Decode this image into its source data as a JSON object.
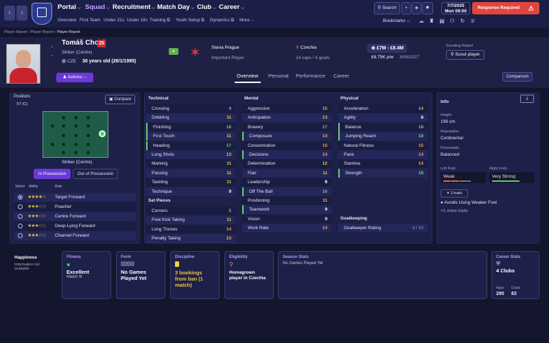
{
  "nav": {
    "main": [
      {
        "label": "Portal"
      },
      {
        "label": "Squad"
      },
      {
        "label": "Recruitment"
      },
      {
        "label": "Match Day"
      },
      {
        "label": "Club"
      },
      {
        "label": "Career"
      }
    ],
    "sub": [
      "Overview",
      "First Team",
      "Under 21s",
      "Under 18s",
      "Training",
      "Youth Setup",
      "Dynamics",
      "More"
    ],
    "search": "Search",
    "date": "7/7/2025",
    "day_time": "Mon 09:00",
    "response": "Response Required",
    "bookmarks": "Bookmarks"
  },
  "breadcrumb": [
    "Player Report",
    "Player Report",
    "Player Report"
  ],
  "player": {
    "name": "Tomáš Chorý",
    "number": "25",
    "position": "Striker (Centre)",
    "nation_code": "CZE",
    "age": "30 years old (26/1/1995)",
    "club": "Slavia Prague",
    "status": "Important Player",
    "nationality": "Czechia",
    "caps": "14 caps / 4 goals",
    "value": "£7M - £8.4M",
    "wage": "£8.75K p/w",
    "contract": "30/6/2027",
    "scouting_label": "Scouting Report",
    "scout_btn": "Scout player",
    "actions": "Actions"
  },
  "tabs": [
    "Overview",
    "Personal",
    "Performance",
    "Career"
  ],
  "comparison": "Comparison",
  "positions": {
    "title": "Positions",
    "pos": "ST (C)",
    "compare": "Compare",
    "role_title": "Striker (Centre)",
    "in_possession": "In Possession",
    "out_possession": "Out of Possession",
    "headers": [
      "Select",
      "Ability",
      "Role"
    ],
    "roles": [
      {
        "name": "Target Forward",
        "stars": "★★★★☆"
      },
      {
        "name": "Poacher",
        "stars": "★★★☆☆"
      },
      {
        "name": "Centre Forward",
        "stars": "★★★☆☆"
      },
      {
        "name": "Deep-Lying Forward",
        "stars": "★★★☆☆"
      },
      {
        "name": "Channel Forward",
        "stars": "★★★☆☆"
      }
    ]
  },
  "technical": {
    "title": "Technical",
    "rows": [
      {
        "name": "Crossing",
        "value": "4"
      },
      {
        "name": "Dribbling",
        "value": "11"
      },
      {
        "name": "Finishing",
        "value": "16"
      },
      {
        "name": "First Touch",
        "value": "11"
      },
      {
        "name": "Heading",
        "value": "17"
      },
      {
        "name": "Long Shots",
        "value": "13"
      },
      {
        "name": "Marking",
        "value": "11"
      },
      {
        "name": "Passing",
        "value": "11"
      },
      {
        "name": "Tackling",
        "value": "11"
      },
      {
        "name": "Technique",
        "value": "9"
      }
    ]
  },
  "set_pieces": {
    "title": "Set Pieces",
    "rows": [
      {
        "name": "Corners",
        "value": "5"
      },
      {
        "name": "Free Kick Taking",
        "value": "11"
      },
      {
        "name": "Long Throws",
        "value": "14"
      },
      {
        "name": "Penalty Taking",
        "value": "13"
      }
    ]
  },
  "mental": {
    "title": "Mental",
    "rows": [
      {
        "name": "Aggression",
        "value": "15"
      },
      {
        "name": "Anticipation",
        "value": "13"
      },
      {
        "name": "Bravery",
        "value": "17"
      },
      {
        "name": "Composure",
        "value": "14"
      },
      {
        "name": "Concentration",
        "value": "15"
      },
      {
        "name": "Decisions",
        "value": "14"
      },
      {
        "name": "Determination",
        "value": "12"
      },
      {
        "name": "Flair",
        "value": "11"
      },
      {
        "name": "Leadership",
        "value": "8"
      },
      {
        "name": "Off The Ball",
        "value": "16"
      },
      {
        "name": "Positioning",
        "value": "11"
      },
      {
        "name": "Teamwork",
        "value": "9"
      },
      {
        "name": "Vision",
        "value": "9"
      },
      {
        "name": "Work Rate",
        "value": "14"
      }
    ]
  },
  "physical": {
    "title": "Physical",
    "rows": [
      {
        "name": "Acceleration",
        "value": "14"
      },
      {
        "name": "Agility",
        "value": "8"
      },
      {
        "name": "Balance",
        "value": "18"
      },
      {
        "name": "Jumping Reach",
        "value": "18"
      },
      {
        "name": "Natural Fitness",
        "value": "15"
      },
      {
        "name": "Pace",
        "value": "14"
      },
      {
        "name": "Stamina",
        "value": "14"
      },
      {
        "name": "Strength",
        "value": "18"
      }
    ]
  },
  "goalkeeping": {
    "title": "Goalkeeping",
    "name": "Goalkeeper Rating",
    "value": "3 / 10"
  },
  "info": {
    "title": "Info",
    "height_label": "Height",
    "height": "199 cm",
    "rep_label": "Reputation",
    "rep": "Continental",
    "pers_label": "Personality",
    "pers": "Balanced",
    "lf_label": "Left Foot",
    "lf": "Weak",
    "rf_label": "Right Foot",
    "rf": "Very Strong",
    "traits_btn": "2 traits",
    "trait1": "Avoids Using Weaker Foot",
    "more_traits": "+1 more traits"
  },
  "cards": {
    "happiness": {
      "title": "Happiness",
      "text": "Information not available"
    },
    "fitness": {
      "title": "Fitness",
      "main": "Excellent",
      "sub": "Match fit"
    },
    "form": {
      "title": "Form",
      "badge": "-",
      "main": "No Games Played Yet"
    },
    "discipline": {
      "title": "Discipline",
      "main": "3 bookings from ban (1 match)"
    },
    "eligibility": {
      "title": "Eligibility",
      "main": "Homegrown player in Czechia"
    },
    "season": {
      "title": "Season Stats",
      "text": "No Games Played Yet"
    },
    "career": {
      "title": "Career Stats",
      "main": "4 Clubs",
      "apps_label": "Apps",
      "apps": "290",
      "goals_label": "Goals",
      "goals": "83"
    }
  },
  "colors": {
    "accent": "#6b39d9",
    "response": "#e2453e",
    "good": "#67d36f",
    "mid": "#f0c34a"
  }
}
